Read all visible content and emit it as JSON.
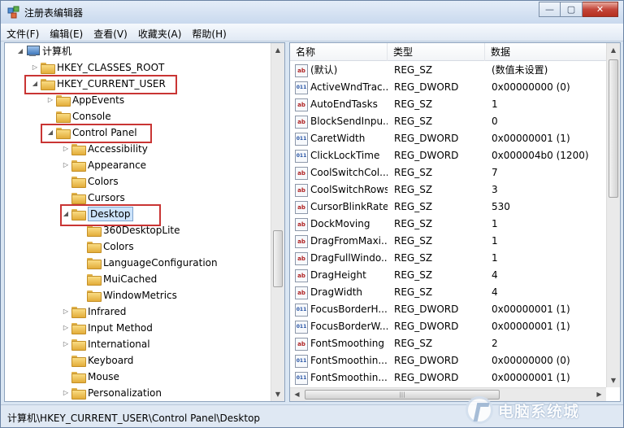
{
  "window": {
    "title": "注册表编辑器",
    "controls": [
      "—",
      "▢",
      "✕"
    ]
  },
  "menu": [
    "文件(F)",
    "编辑(E)",
    "查看(V)",
    "收藏夹(A)",
    "帮助(H)"
  ],
  "tree": {
    "root": "计算机",
    "classes_root": "HKEY_CLASSES_ROOT",
    "current_user": "HKEY_CURRENT_USER",
    "cu_children": [
      "AppEvents",
      "Console",
      "Control Panel"
    ],
    "cp_children_before": [
      "Accessibility",
      "Appearance",
      "Colors",
      "Cursors"
    ],
    "desktop": "Desktop",
    "desktop_children": [
      "360DesktopLite",
      "Colors",
      "LanguageConfiguration",
      "MuiCached",
      "WindowMetrics"
    ],
    "cp_children_after": [
      "Infrared",
      "Input Method",
      "International",
      "Keyboard",
      "Mouse",
      "Personalization"
    ]
  },
  "list": {
    "headers": {
      "name": "名称",
      "type": "类型",
      "data": "数据"
    },
    "rows": [
      {
        "icon": "ab",
        "name": "(默认)",
        "type": "REG_SZ",
        "data": "(数值未设置)"
      },
      {
        "icon": "dword",
        "name": "ActiveWndTrac...",
        "type": "REG_DWORD",
        "data": "0x00000000 (0)"
      },
      {
        "icon": "ab",
        "name": "AutoEndTasks",
        "type": "REG_SZ",
        "data": "1"
      },
      {
        "icon": "ab",
        "name": "BlockSendInpu...",
        "type": "REG_SZ",
        "data": "0"
      },
      {
        "icon": "dword",
        "name": "CaretWidth",
        "type": "REG_DWORD",
        "data": "0x00000001 (1)"
      },
      {
        "icon": "dword",
        "name": "ClickLockTime",
        "type": "REG_DWORD",
        "data": "0x000004b0 (1200)"
      },
      {
        "icon": "ab",
        "name": "CoolSwitchCol...",
        "type": "REG_SZ",
        "data": "7"
      },
      {
        "icon": "ab",
        "name": "CoolSwitchRows",
        "type": "REG_SZ",
        "data": "3"
      },
      {
        "icon": "ab",
        "name": "CursorBlinkRate",
        "type": "REG_SZ",
        "data": "530"
      },
      {
        "icon": "ab",
        "name": "DockMoving",
        "type": "REG_SZ",
        "data": "1"
      },
      {
        "icon": "ab",
        "name": "DragFromMaxi...",
        "type": "REG_SZ",
        "data": "1"
      },
      {
        "icon": "ab",
        "name": "DragFullWindo...",
        "type": "REG_SZ",
        "data": "1"
      },
      {
        "icon": "ab",
        "name": "DragHeight",
        "type": "REG_SZ",
        "data": "4"
      },
      {
        "icon": "ab",
        "name": "DragWidth",
        "type": "REG_SZ",
        "data": "4"
      },
      {
        "icon": "dword",
        "name": "FocusBorderH...",
        "type": "REG_DWORD",
        "data": "0x00000001 (1)"
      },
      {
        "icon": "dword",
        "name": "FocusBorderW...",
        "type": "REG_DWORD",
        "data": "0x00000001 (1)"
      },
      {
        "icon": "ab",
        "name": "FontSmoothing",
        "type": "REG_SZ",
        "data": "2"
      },
      {
        "icon": "dword",
        "name": "FontSmoothin...",
        "type": "REG_DWORD",
        "data": "0x00000000 (0)"
      },
      {
        "icon": "dword",
        "name": "FontSmoothin...",
        "type": "REG_DWORD",
        "data": "0x00000001 (1)"
      }
    ]
  },
  "icon_labels": {
    "ab": "ab",
    "dword": "011"
  },
  "status": "计算机\\HKEY_CURRENT_USER\\Control Panel\\Desktop",
  "watermark": {
    "text": "电脑系统城"
  },
  "colors": {
    "highlight_box": "#c93534",
    "selection": "#cde4fb"
  }
}
